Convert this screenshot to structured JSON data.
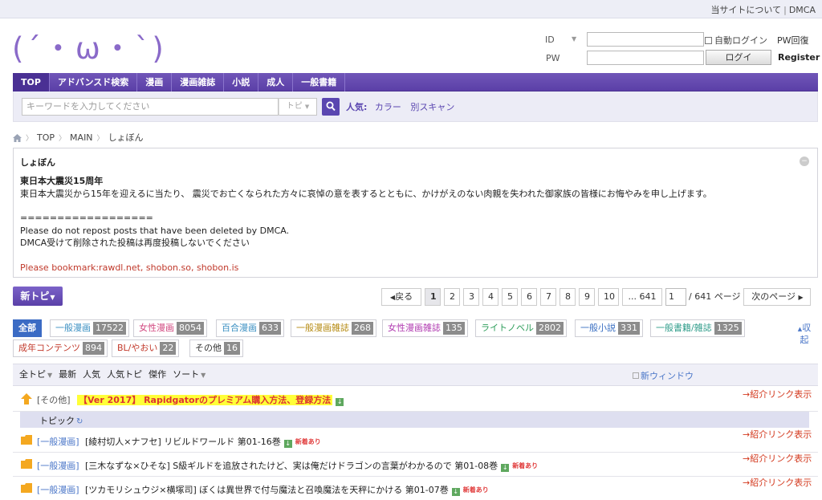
{
  "topbar": {
    "about": "当サイトについて",
    "dmca": "DMCA"
  },
  "logo": {
    "text": "(´・ω・`)"
  },
  "login": {
    "id_label": "ID",
    "pw_label": "PW",
    "auto_login": "自動ログイン",
    "pw_recover": "PW回復",
    "login_button": "ログイ",
    "register": "Register",
    "id_value": "",
    "pw_value": ""
  },
  "nav": {
    "items": [
      "TOP",
      "アドバンスド検索",
      "漫画",
      "漫画雑誌",
      "小説",
      "成人",
      "一般書籍"
    ]
  },
  "search": {
    "placeholder": "キーワードを入力してください",
    "scope": "トピ",
    "popular_label": "人気:",
    "popular_tags": [
      "カラー",
      "別スキャン"
    ]
  },
  "breadcrumb": {
    "items": [
      "TOP",
      "MAIN",
      "しょぼん"
    ]
  },
  "notice": {
    "title": "しょぼん",
    "heading": "東日本大震災15周年",
    "line1": "東日本大震災から15年を迎えるに当たり、 震災でお亡くなられた方々に哀悼の意を表するとともに、かけがえのない肉親を失われた御家族の皆様にお悔やみを申し上げます。",
    "divider": "==================",
    "line2": "Please do not repost posts that have been deleted by DMCA.",
    "line3": "DMCA受けて削除された投稿は再度投稿しないでください",
    "line4": "Please bookmark:rawdl.net, shobon.so, shobon.is"
  },
  "newtopic": {
    "label": "新トピ"
  },
  "pager": {
    "prev": "戻る",
    "pages": [
      "1",
      "2",
      "3",
      "4",
      "5",
      "6",
      "7",
      "8",
      "9",
      "10"
    ],
    "current": "1",
    "ellipsis": "... 641",
    "input_value": "1",
    "total": "/ 641 ページ",
    "next": "次のページ"
  },
  "categories": [
    {
      "label": "全部",
      "count": ""
    },
    {
      "label": "一般漫画",
      "count": "17522"
    },
    {
      "label": "女性漫画",
      "count": "8054"
    },
    {
      "label": "百合漫画",
      "count": "633"
    },
    {
      "label": "一般漫画雑誌",
      "count": "268"
    },
    {
      "label": "女性漫画雑誌",
      "count": "135"
    },
    {
      "label": "ライトノベル",
      "count": "2802"
    },
    {
      "label": "一般小説",
      "count": "331"
    },
    {
      "label": "一般書籍/雑誌",
      "count": "1325"
    },
    {
      "label": "成年コンテンツ",
      "count": "894"
    },
    {
      "label": "BL/やおい",
      "count": "22"
    },
    {
      "label": "その他",
      "count": "16"
    }
  ],
  "category_colors": {
    "一般漫画": "#3a8fc2",
    "女性漫画": "#d1477f",
    "百合漫画": "#3a8fc2",
    "一般漫画雑誌": "#b58a12",
    "女性漫画雑誌": "#b03ab0",
    "ライトノベル": "#2d9d5a",
    "一般小説": "#3a6fc2",
    "一般書籍/雑誌": "#2f9c8a",
    "成年コンテンツ": "#c2392b",
    "BL/やおい": "#c2392b",
    "その他": "#333333"
  },
  "collapse_label": "収起",
  "sortbar": {
    "items": [
      "全トピ",
      "最新",
      "人気",
      "人気トピ",
      "傑作",
      "ソート"
    ],
    "new_window": "新ウィンドウ"
  },
  "topics": [
    {
      "category": "[その他]",
      "title": "【Ver 2017】 Rapidgatorのプレミアム購入方法、登録方法",
      "link": "→紹介リンク表示",
      "pinned": true
    },
    {
      "category": "[一般漫画]",
      "title": "[綾村切人×ナフセ] リビルドワールド 第01-16巻",
      "link": "→紹介リンク表示",
      "badge": "新着あり"
    },
    {
      "category": "[一般漫画]",
      "title": "[三木なずな×ひそな] S級ギルドを追放されたけど、実は俺だけドラゴンの言葉がわかるので 第01-08巻",
      "link": "→紹介リンク表示",
      "badge": "新着あり"
    },
    {
      "category": "[一般漫画]",
      "title": "[ツカモリシュウジ×横塚司] ぼくは異世界で付与魔法と召喚魔法を天秤にかける 第01-07巻",
      "link": "→紹介リンク表示",
      "badge": "新着あり"
    }
  ],
  "subhead": {
    "label": "トピック"
  }
}
